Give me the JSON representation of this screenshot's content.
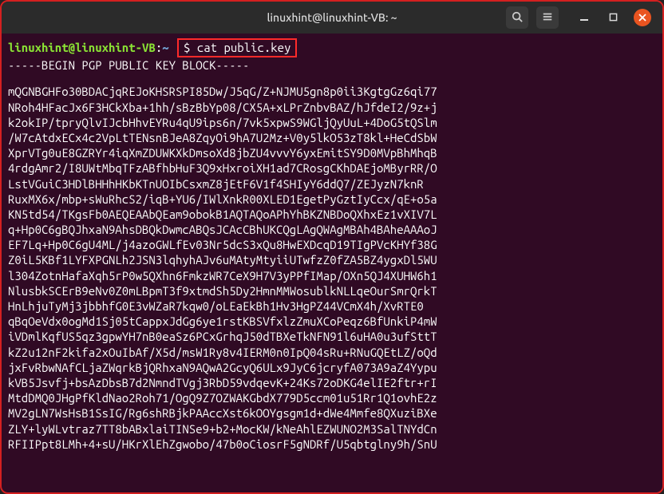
{
  "titlebar": {
    "title": "linuxhint@linuxhint-VB: ~"
  },
  "prompt": {
    "user_host": "linuxhint@linuxhint-VB",
    "sep": ":",
    "path": "~",
    "dollar": "$",
    "command": "cat public.key"
  },
  "pgp": {
    "begin": "-----BEGIN PGP PUBLIC KEY BLOCK-----",
    "lines": [
      "mQGNBGHFo30BDACjqREJoKHSRSPI85Dw/J5qG/Z+NJMU5gn8p0ii3KgtgGz6qi77",
      "NRoh4HFacJx6F3HCkXba+1hh/sBzBbYp08/CX5A+xLPrZnbvBAZ/hJfdeI2/9z+j",
      "k2okIP/tpryQlvIJcbHhvEYRu4qU9ips6n/7vk5xpwS9WGljQyUuL+4DoG5tQSlm",
      "/W7cAtdxECx4c2VpLtTENsnBJeA8ZqyOi9hA7U2Mz+V0y5lkO53zT8kl+HeCdSbW",
      "XprVTg0uE8GZRYr4iqXmZDUWKXkDmsoXd8jbZU4vvvY6yxEmitSY9D0MVpBhMhqB",
      "4rdgAmr2/I8UWtMbqTFzABfhbHuF3Q9xHxroiXH1ad7CRosgCKhDAEjoMByrRR/O",
      "LstVGuiC3HDlBHHhHKbKTnUOIbCsxmZ8jEtF6V1f4SHIyY6ddQ7/ZEJyzN7knR",
      "RuxMX6x/mbp+sWuRhcS2/iqB+YU6/IWlXnkR00XLED1EgetPyGztIyCcx/qE+o5a",
      "KN5td54/TKgsFb0AEQEAAbQEam9obokB1AQTAQoAPhYhBKZNBDoQXhxEz1vXIV7L",
      "q+Hp0C6gBQJhxaN9AhsDBQkDwmcABQsJCAcCBhUKCQgLAgQWAgMBAh4BAheAAAoJ",
      "EF7Lq+Hp0C6gU4ML/j4azoGWLfEv03Nr5dcS3xQu8HwEXDcqD19TIgPVcKHYf38G",
      "Z0iL5KBf1LYFXPGNLh2JSN3lqhyhAJv6uMAtyMtyiiUTwfzZ0fZA5BZ4ygxDl5WU",
      "l304ZotnHafaXqh5rP0w5QXhn6FmkzWR7CeX9H7V3yPPfIMap/OXn5QJ4XUHW6h1",
      "NlusbkSCErB9eNv0Z0mLBpmT3f9xtmdSh5Dy2HmnMMWosublkNLLqeOurSmrQrkT",
      "HnLhjuTyMj3jbbhfG0E3vWZaR7kqw0/oLEaEkBh1Hv3HgPZ44VCmX4h/XvRTE0",
      "qBqOeVdx0ogMd1Sj05tCappxJdGg6ye1rstKBSVfxlzZmuXCoPeqz6BfUnkiP4mW",
      "iVDmlKqfUS5qz3gpwYH7nB0eaSz6PCxGrhqJ50dTBXeTkNFN91l6uHA0u3ufSttT",
      "kZ2u12nF2kifa2xOuIbAf/X5d/msW1Ry8v4IERM0n0IpQ04sRu+RNuGQEtLZ/oQd",
      "jxFvRbwNAfCLjaZWqrkBjQRhxaN9AQwA2GcyQ6ULx9JyC6jcryfA073A9aZ4Yypu",
      "kVB5Jsvfj+bsAzDbsB7d2NmndTVgj3RbD59vdqevK+24Ks72oDKG4elIE2ftr+rI",
      "MtdDMQ0JHgPfKldNao2Roh71/OgQ9Z7OZWAKGbdX779D5ccm01u51Rr1Q1ovhE2z",
      "MV2gLN7WsHsB1SsIG/Rg6shRBjkPAAccXst6kOOYgsgm1d+dWe4Mmfe8QXuziBXe",
      "ZLY+lyWLvtraz7TT8bABxlaiTINSe9+b2+MocKW/kNeAhlEZWUNO2M3SalTNYdCn",
      "RFIIPpt8LMh+4+sU/HKrXlEhZgwobo/47b0oCiosrF5gNDRf/U5qbtglny9h/SnU"
    ]
  }
}
